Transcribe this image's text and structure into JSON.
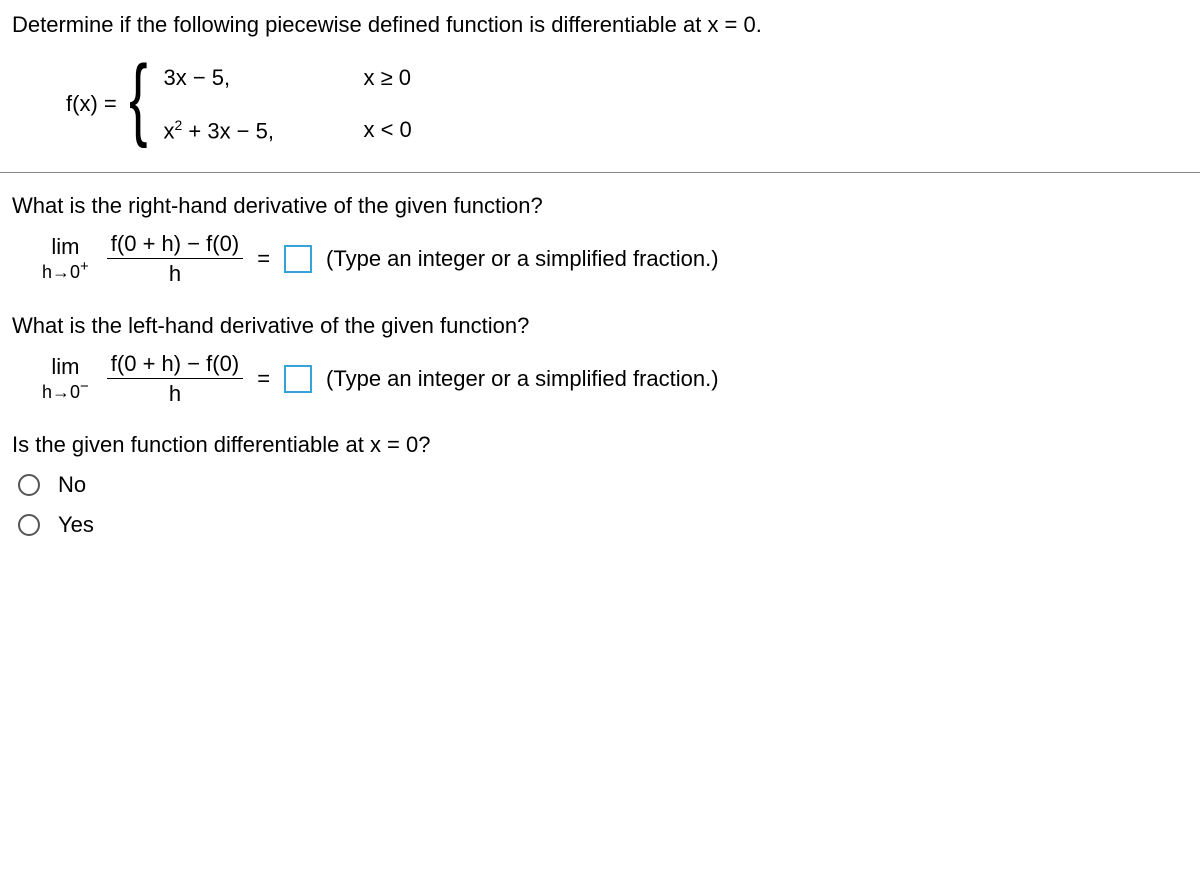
{
  "question": {
    "statement": "Determine if the following piecewise defined function is differentiable at x = 0.",
    "fx_label": "f(x) =",
    "case1_expr": "3x − 5,",
    "case1_cond": "x ≥ 0",
    "case2_expr_prefix": "x",
    "case2_expr_exp": "2",
    "case2_expr_suffix": " + 3x − 5,",
    "case2_cond": "x < 0"
  },
  "part1": {
    "prompt": "What is the right-hand derivative of the given function?",
    "lim_word": "lim",
    "lim_sub_prefix": "h→0",
    "lim_sub_sign": "+",
    "frac_num": "f(0 + h) − f(0)",
    "frac_den": "h",
    "equals": "=",
    "hint": "(Type an integer or a simplified fraction.)"
  },
  "part2": {
    "prompt": "What is the left-hand derivative of the given function?",
    "lim_word": "lim",
    "lim_sub_prefix": "h→0",
    "lim_sub_sign": "−",
    "frac_num": "f(0 + h) − f(0)",
    "frac_den": "h",
    "equals": "=",
    "hint": "(Type an integer or a simplified fraction.)"
  },
  "part3": {
    "prompt": "Is the given function differentiable at x = 0?",
    "option_no": "No",
    "option_yes": "Yes"
  }
}
